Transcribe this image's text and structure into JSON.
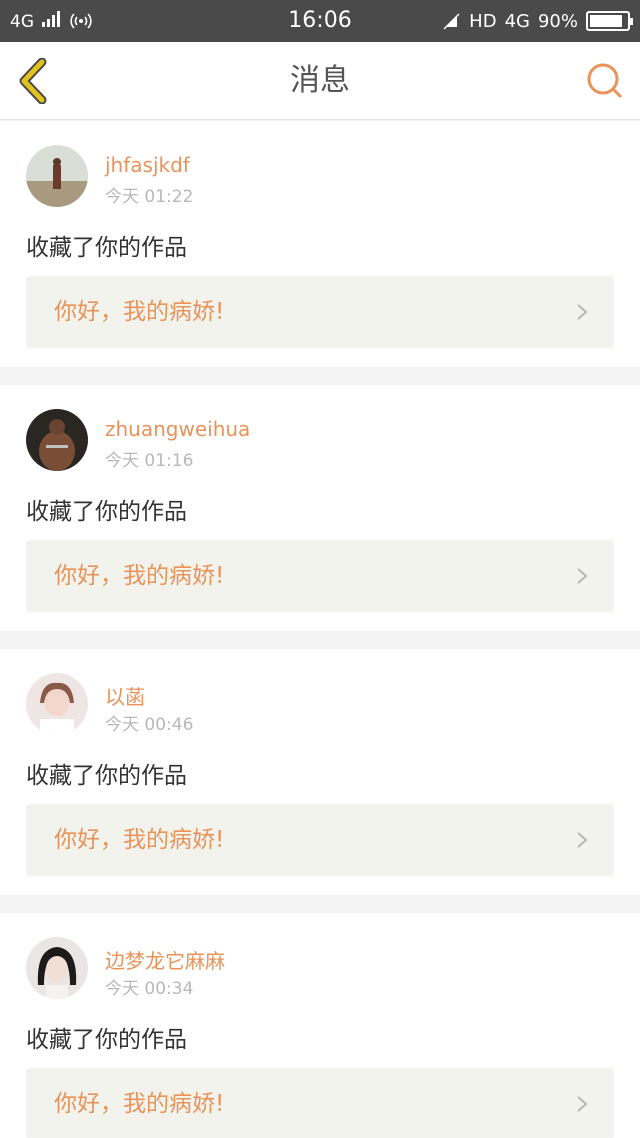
{
  "status_bar": {
    "network": "4G",
    "time": "16:06",
    "hd": "HD",
    "network_right": "4G",
    "battery": "90%",
    "battery_level": 0.9
  },
  "header": {
    "title": "消息"
  },
  "messages": [
    {
      "user": "jhfasjkdf",
      "time": "今天 01:22",
      "action": "收藏了你的作品",
      "work_title": "你好，我的病娇!"
    },
    {
      "user": "zhuangweihua",
      "time": "今天 01:16",
      "action": "收藏了你的作品",
      "work_title": "你好，我的病娇!"
    },
    {
      "user": "以菡",
      "time": "今天 00:46",
      "action": "收藏了你的作品",
      "work_title": "你好，我的病娇!"
    },
    {
      "user": "边梦龙它麻麻",
      "time": "今天 00:34",
      "action": "收藏了你的作品",
      "work_title": "你好，我的病娇!"
    }
  ],
  "colors": {
    "accent": "#e8935a",
    "status_bar_bg": "#4a4a4a",
    "card_bg": "#ffffff",
    "work_bg": "#f3f3ed",
    "back_icon": "#e2c31d"
  },
  "icons": {
    "back": "chevron-left-icon",
    "search": "search-icon",
    "work_arrow": "chevron-right-icon"
  }
}
